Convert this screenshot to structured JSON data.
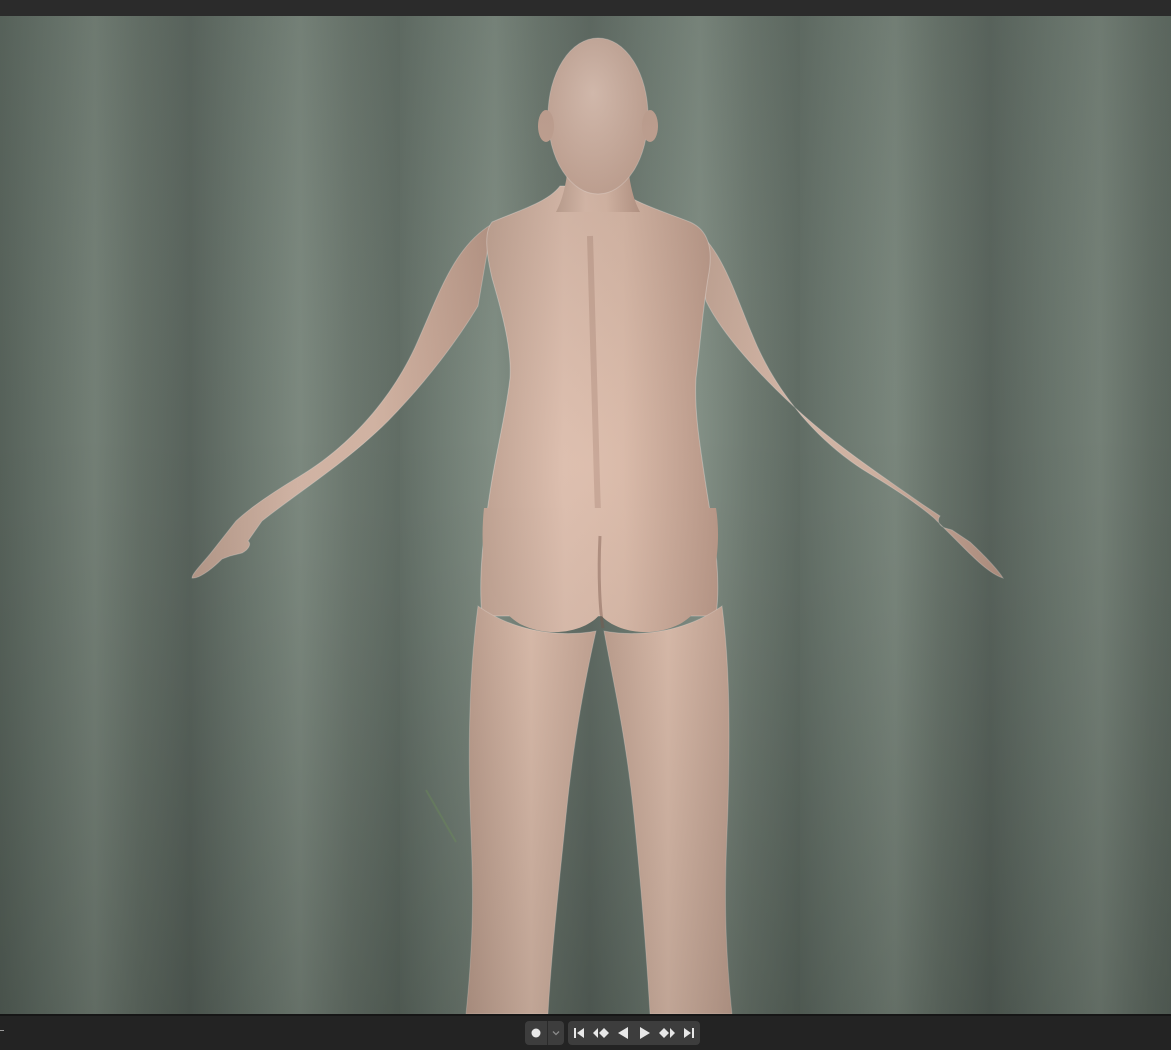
{
  "viewport": {
    "background_color": "#6c7a70",
    "skin_color": "#d6b3a0",
    "description_icon": "human-figure-back-view"
  },
  "timeline": {
    "controls": [
      {
        "name": "record-keyframe",
        "icon": "record-dot-icon"
      },
      {
        "name": "keying-dropdown",
        "icon": "chevron-down-icon"
      },
      {
        "name": "jump-to-start",
        "icon": "jump-start-icon"
      },
      {
        "name": "jump-to-previous-keyframe",
        "icon": "prev-keyframe-icon"
      },
      {
        "name": "play-reverse",
        "icon": "play-reverse-icon"
      },
      {
        "name": "play",
        "icon": "play-icon"
      },
      {
        "name": "jump-to-next-keyframe",
        "icon": "next-keyframe-icon"
      },
      {
        "name": "jump-to-end",
        "icon": "jump-end-icon"
      }
    ]
  }
}
